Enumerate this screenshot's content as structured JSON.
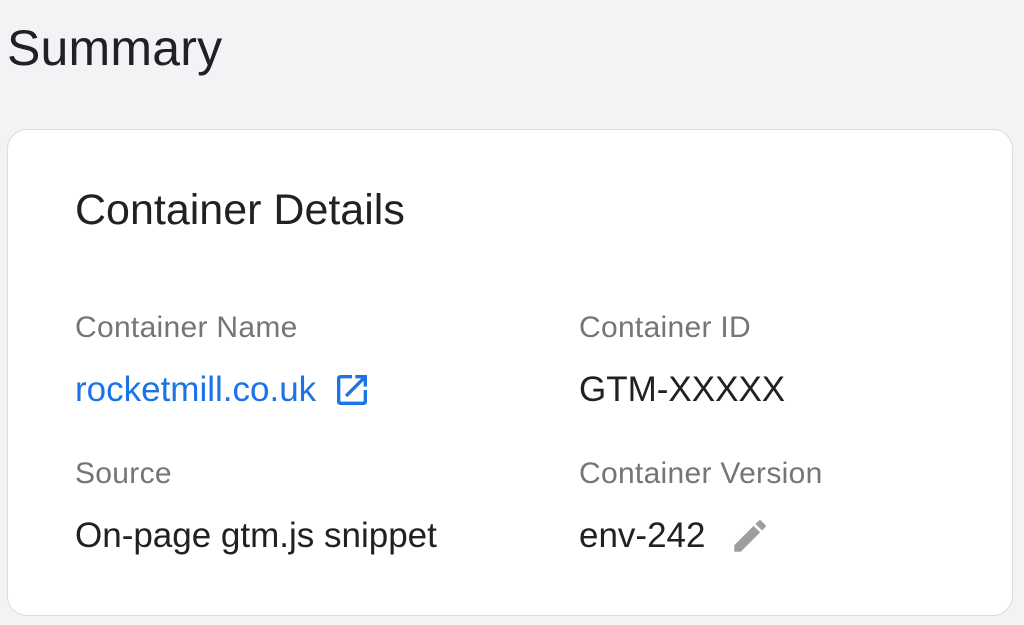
{
  "page": {
    "title": "Summary"
  },
  "card": {
    "title": "Container Details",
    "fields": {
      "container_name": {
        "label": "Container Name",
        "value": "rocketmill.co.uk",
        "icon": "open-in-new-icon"
      },
      "container_id": {
        "label": "Container ID",
        "value": "GTM-XXXXX"
      },
      "source": {
        "label": "Source",
        "value": "On-page gtm.js snippet"
      },
      "container_version": {
        "label": "Container Version",
        "value": "env-242",
        "icon": "edit-pencil-icon"
      }
    }
  },
  "colors": {
    "background": "#f1f3f4",
    "link": "#1a73e8",
    "label": "#757575",
    "text": "#202124",
    "icon_gray": "#9e9e9e"
  }
}
